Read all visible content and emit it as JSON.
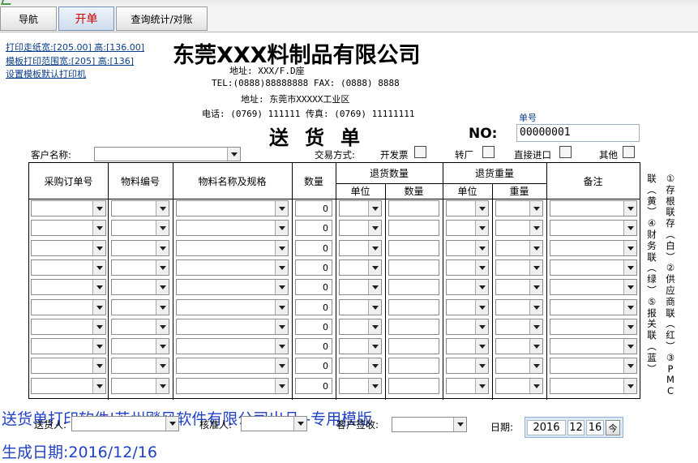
{
  "tabs": [
    {
      "label": "导航"
    },
    {
      "label": "开单"
    },
    {
      "label": "查询统计/对账"
    }
  ],
  "links": {
    "paper_size": "打印走纸宽:[205.00] 高:[136.00]",
    "template_range": "模板打印范围宽:[205] 高:[136]",
    "default_printer": "设置模板默认打印机"
  },
  "company": {
    "name": "东莞XXX料制品有限公司",
    "address1": "地址: XXX/F.D座",
    "tel_fax1": "TEL:(0888)88888888  FAX: (0888) 8888",
    "address2": "地址: 东莞市XXXXX工业区",
    "tel_fax2": "电话: (0769) 111111  传真: (0769) 11111111"
  },
  "document": {
    "title": "送货单",
    "no_label": "NO:",
    "order_no_label": "单号",
    "order_no": "00000001"
  },
  "form": {
    "customer_label": "客户名称:",
    "trade_label": "交易方式:",
    "options": [
      {
        "label": "开发票"
      },
      {
        "label": "转厂"
      },
      {
        "label": "直接进口"
      },
      {
        "label": "其他"
      }
    ]
  },
  "table": {
    "headers": {
      "po": "采购订单号",
      "material_no": "物料编号",
      "material_name": "物料名称及规格",
      "qty": "数量",
      "return_qty": "退货数量",
      "return_weight": "退货重量",
      "unit": "单位",
      "count": "数量",
      "unit2": "单位",
      "weight": "重量",
      "remark": "备注"
    },
    "rows": [
      "0",
      "0",
      "0",
      "0",
      "0",
      "0",
      "0",
      "0",
      "0",
      "0"
    ]
  },
  "side_text": {
    "col1": [
      "联",
      "︵",
      "黄",
      "︶",
      "④",
      "财",
      "务",
      "联",
      "︵",
      "绿",
      "︶",
      "⑤",
      "报",
      "关",
      "联",
      "︵",
      "蓝",
      "︶"
    ],
    "col2": [
      "①",
      "存",
      "根",
      "联",
      "存",
      "︵",
      "白",
      "︶",
      "②",
      "供",
      "应",
      "商",
      "联",
      "︵",
      "红",
      "︶",
      "③",
      "P",
      "M",
      "C"
    ]
  },
  "bottom": {
    "sender_label": "送货人:",
    "checker_label": "核准人:",
    "signer_label": "客户签收:",
    "date_label": "日期:",
    "date_year": "2016",
    "date_month": "12",
    "date_day": "16",
    "calendar_glyph": "今"
  },
  "footer": {
    "product_line": "送货单打印软件|苏州飚风软件有限公司出品--专用模版",
    "generated": "生成日期:2016/12/16"
  }
}
